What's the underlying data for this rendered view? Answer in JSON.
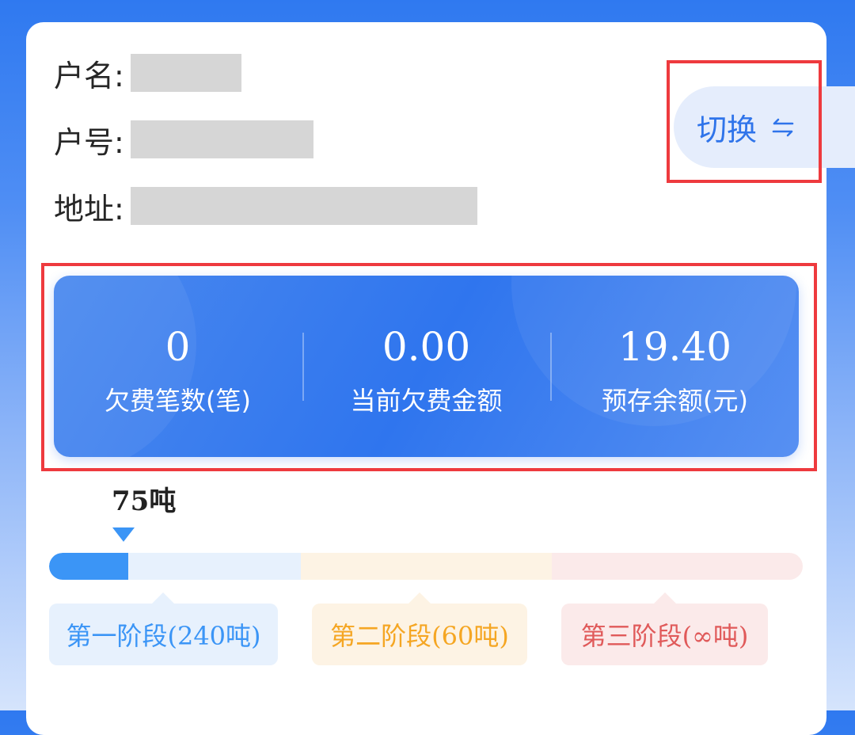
{
  "account": {
    "name_label": "户名:",
    "number_label": "户号:",
    "address_label": "地址:"
  },
  "switch": {
    "label": "切换",
    "icon": "swap-arrows-icon"
  },
  "stats": [
    {
      "value": "0",
      "label": "欠费笔数(笔)"
    },
    {
      "value": "0.00",
      "label": "当前欠费金额"
    },
    {
      "value": "19.40",
      "label": "预存余额(元)"
    }
  ],
  "usage": {
    "label": "75吨",
    "progress_fraction": 0.105
  },
  "tiers": [
    {
      "label": "第一阶段(240吨)",
      "color": "#3b95f6"
    },
    {
      "label": "第二阶段(60吨)",
      "color": "#f5a623"
    },
    {
      "label": "第三阶段(∞吨)",
      "color": "#e05a5a"
    }
  ],
  "colors": {
    "brand_blue": "#2f75ee",
    "highlight_outline": "#ee3a3e"
  }
}
